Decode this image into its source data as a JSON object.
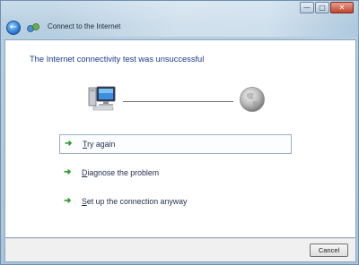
{
  "window": {
    "title": "Connect to the Internet",
    "controls": [
      "minimize-icon",
      "maximize-icon",
      "close-icon"
    ]
  },
  "content": {
    "heading": "The Internet connectivity test was unsuccessful",
    "diagram_icons": [
      "computer-icon",
      "globe-icon"
    ],
    "options": [
      {
        "label": "Try again",
        "icon": "green-arrow-icon",
        "selected": true
      },
      {
        "label": "Diagnose the problem",
        "icon": "green-arrow-icon",
        "selected": false
      },
      {
        "label": "Set up the connection anyway",
        "icon": "green-arrow-icon",
        "selected": false
      }
    ]
  },
  "footer": {
    "cancel_label": "Cancel"
  },
  "colors": {
    "heading": "#1c3b8d",
    "arrow": "#2e9b2e",
    "frame": "#b7cfe1"
  }
}
